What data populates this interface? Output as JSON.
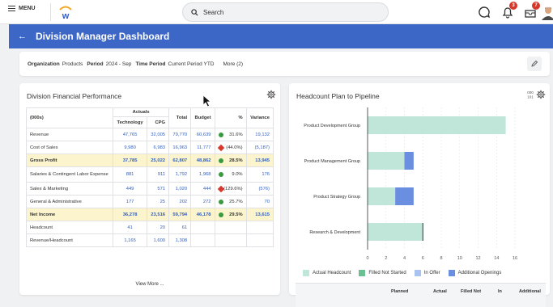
{
  "topbar": {
    "menu_label": "MENU",
    "search_placeholder": "Search",
    "notifications_count": "3",
    "inbox_count": "7"
  },
  "header": {
    "back_symbol": "←",
    "title": "Division Manager Dashboard"
  },
  "filters": {
    "org_key": "Organization",
    "org_value": "Products",
    "period_key": "Period",
    "period_value": "2024 - Sep",
    "time_period_key": "Time Period",
    "time_period_value": "Current Period YTD",
    "more_label": "More (2)"
  },
  "financial": {
    "title": "Division Financial Performance",
    "view_more": "View More ...",
    "units_label": "(000s)",
    "group_header": "Actuals",
    "columns": [
      "Technology",
      "CPG",
      "Total",
      "Budget",
      "%",
      "Variance"
    ],
    "rows": [
      {
        "label": "Revenue",
        "tech": "47,765",
        "cpg": "32,005",
        "total": "79,770",
        "budget": "60,639",
        "pct": "31.6%",
        "status": "good",
        "variance": "19,132",
        "highlight": false
      },
      {
        "label": "Cost of Sales",
        "tech": "9,980",
        "cpg": "6,983",
        "total": "16,963",
        "budget": "11,777",
        "pct": "(44.0%)",
        "status": "bad",
        "variance": "(5,187)",
        "highlight": false
      },
      {
        "label": "Gross Profit",
        "tech": "37,785",
        "cpg": "25,022",
        "total": "62,807",
        "budget": "48,862",
        "pct": "28.5%",
        "status": "good",
        "variance": "13,945",
        "highlight": true
      },
      {
        "label": "Salaries & Contingent Labor Expense",
        "tech": "881",
        "cpg": "911",
        "total": "1,792",
        "budget": "1,968",
        "pct": "9.0%",
        "status": "good",
        "variance": "176",
        "highlight": false
      },
      {
        "label": "Sales & Marketing",
        "tech": "449",
        "cpg": "571",
        "total": "1,020",
        "budget": "444",
        "pct": "(129.6%)",
        "status": "bad",
        "variance": "(576)",
        "highlight": false
      },
      {
        "label": "General & Administrative",
        "tech": "177",
        "cpg": "25",
        "total": "202",
        "budget": "272",
        "pct": "25.7%",
        "status": "good",
        "variance": "70",
        "highlight": false
      },
      {
        "label": "Net Income",
        "tech": "36,278",
        "cpg": "23,516",
        "total": "59,794",
        "budget": "46,178",
        "pct": "29.5%",
        "status": "good",
        "variance": "13,615",
        "highlight": true
      },
      {
        "label": "Headcount",
        "tech": "41",
        "cpg": "20",
        "total": "61",
        "budget": "",
        "pct": "",
        "status": "",
        "variance": "",
        "highlight": false
      },
      {
        "label": "Revenue/Headcount",
        "tech": "1,165",
        "cpg": "1,600",
        "total": "1,308",
        "budget": "",
        "pct": "",
        "status": "",
        "variance": "",
        "highlight": false
      }
    ]
  },
  "headcount": {
    "title": "Headcount Plan to Pipeline",
    "table_columns": [
      "Planned",
      "Actual",
      "Filled Not",
      "In",
      "Additional"
    ]
  },
  "chart_data": {
    "type": "bar",
    "orientation": "horizontal",
    "stacked": true,
    "categories": [
      "Product Development Group",
      "Product Management Group",
      "Product Strategy Group",
      "Research & Development"
    ],
    "series": [
      {
        "name": "Actual Headcount",
        "color": "#bfe6d9",
        "values": [
          15,
          4,
          3,
          6
        ]
      },
      {
        "name": "Filled Not Started",
        "color": "#6dbf94",
        "values": [
          0,
          0,
          0,
          0
        ]
      },
      {
        "name": "In Offer",
        "color": "#a9c2f0",
        "values": [
          0,
          0,
          0,
          0
        ]
      },
      {
        "name": "Additional Openings",
        "color": "#6b8fe0",
        "values": [
          0,
          1,
          2,
          0
        ]
      }
    ],
    "planned_marker": [
      0,
      0,
      0,
      6
    ],
    "xlim": [
      0,
      16
    ],
    "xticks": [
      0,
      2,
      4,
      6,
      8,
      10,
      12,
      14,
      16
    ],
    "grid": true,
    "legend_position": "bottom"
  }
}
